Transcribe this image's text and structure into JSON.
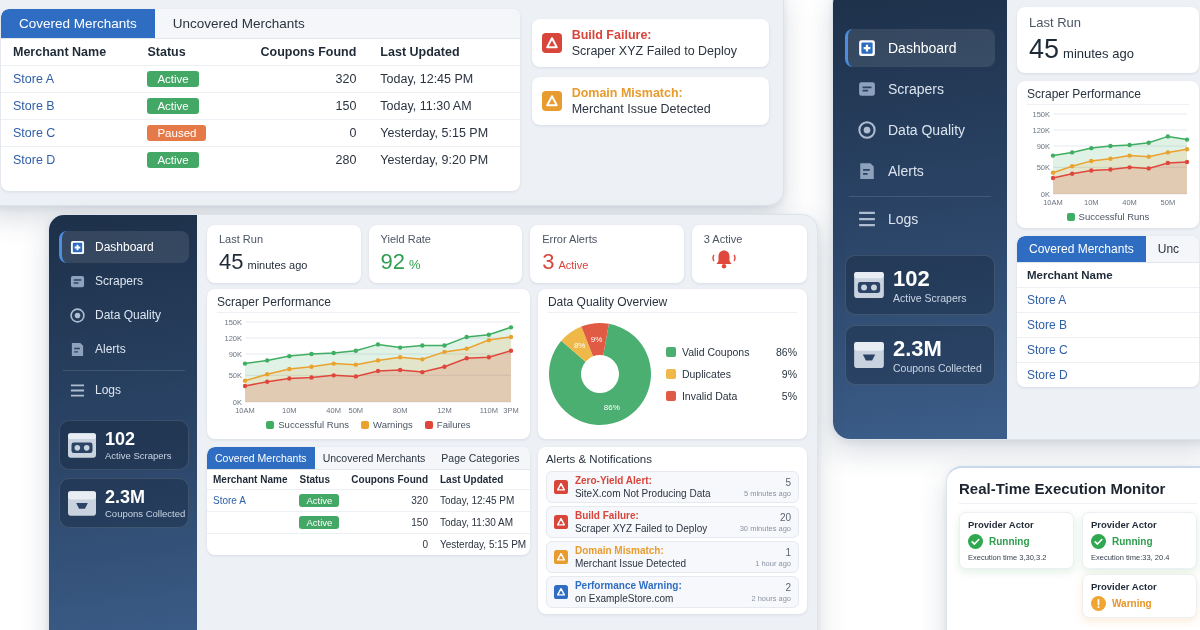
{
  "merchants_panel": {
    "tabs": [
      {
        "label": "Covered Merchants",
        "selected": true
      },
      {
        "label": "Uncovered Merchants",
        "selected": false
      }
    ],
    "table": {
      "columns": [
        "Merchant Name",
        "Status",
        "Coupons Found",
        "Last Updated"
      ],
      "rows": [
        {
          "merchant": "Store A",
          "status": {
            "label": "Active",
            "color": "#43a865"
          },
          "coupons": "320",
          "updated": "Today, 12:45 PM"
        },
        {
          "merchant": "Store B",
          "status": {
            "label": "Active",
            "color": "#43a865"
          },
          "coupons": "150",
          "updated": "Today, 11:30 AM"
        },
        {
          "merchant": "Store C",
          "status": {
            "label": "Paused",
            "color": "#e57a48"
          },
          "coupons": "0",
          "updated": "Yesterday, 5:15 PM"
        },
        {
          "merchant": "Store D",
          "status": {
            "label": "Active",
            "color": "#43a865"
          },
          "coupons": "280",
          "updated": "Yesterday, 9:20 PM"
        }
      ]
    },
    "alerts": [
      {
        "kind": "error",
        "title": "Build Failure:",
        "message": "Scraper XYZ Failed to Deploy"
      },
      {
        "kind": "warning",
        "title": "Domain Mismatch:",
        "message": "Merchant Issue Detected"
      }
    ]
  },
  "right_dashboard": {
    "sidebar": {
      "items": [
        {
          "kind": "dashboard",
          "label": "Dashboard",
          "selected": true
        },
        {
          "kind": "scrapers",
          "label": "Scrapers",
          "selected": false
        },
        {
          "kind": "quality",
          "label": "Data Quality",
          "selected": false
        },
        {
          "kind": "alerts",
          "label": "Alerts",
          "selected": false
        },
        {
          "kind": "logs",
          "label": "Logs",
          "selected": false
        }
      ],
      "stats": [
        {
          "kind": "scrapers",
          "value": "102",
          "label": "Active Scrapers"
        },
        {
          "kind": "coupons",
          "value": "2.3M",
          "label": "Coupons Collected"
        }
      ]
    },
    "last_run": {
      "label": "Last Run",
      "value": "45",
      "unit": "minutes ago"
    },
    "performance": {
      "chart_data": {
        "type": "area",
        "title": "Scraper Performance",
        "categories": [
          "10AM",
          null,
          "10M",
          null,
          "40M",
          null,
          "50M",
          null
        ],
        "ylim": [
          0,
          150000
        ],
        "yticks": [
          {
            "value": 0,
            "label": "0K"
          },
          {
            "value": 50000,
            "label": "50K"
          },
          {
            "value": 90000,
            "label": "90K"
          },
          {
            "value": 120000,
            "label": "120K"
          },
          {
            "value": 150000,
            "label": "150K"
          }
        ],
        "grid": true,
        "series": [
          {
            "name": "Successful Runs",
            "color": "#3fae63",
            "values": [
              72000,
              78000,
              86000,
              90000,
              92000,
              96000,
              108000,
              102000
            ]
          },
          {
            "color": "#eaa22f",
            "values": [
              40000,
              52000,
              62000,
              66000,
              72000,
              70000,
              78000,
              84000
            ]
          },
          {
            "color": "#e0473c",
            "values": [
              30000,
              38000,
              44000,
              46000,
              50000,
              48000,
              58000,
              60000
            ]
          }
        ]
      }
    },
    "tabs": [
      {
        "label": "Covered Merchants",
        "selected": true
      },
      {
        "label": "Unc",
        "selected": false
      }
    ],
    "table": {
      "columns": [
        "Merchant Name"
      ],
      "rows": [
        {
          "merchant": "Store A"
        },
        {
          "merchant": "Store B"
        },
        {
          "merchant": "Store C"
        },
        {
          "merchant": "Store D"
        }
      ]
    }
  },
  "main_dashboard": {
    "sidebar": {
      "items": [
        {
          "kind": "dashboard",
          "label": "Dashboard",
          "selected": true
        },
        {
          "kind": "scrapers",
          "label": "Scrapers",
          "selected": false
        },
        {
          "kind": "quality",
          "label": "Data Quality",
          "selected": false
        },
        {
          "kind": "alerts",
          "label": "Alerts",
          "selected": false
        },
        {
          "kind": "logs",
          "label": "Logs",
          "selected": false
        }
      ],
      "stats": [
        {
          "kind": "scrapers",
          "value": "102",
          "label": "Active Scrapers"
        },
        {
          "kind": "coupons",
          "value": "2.3M",
          "label": "Coupons Collected"
        }
      ]
    },
    "last_run": {
      "label": "Last Run",
      "value": "45",
      "unit": "minutes ago"
    },
    "yield_rate": {
      "label": "Yield Rate",
      "value": "92",
      "unit": "%"
    },
    "error_alerts": {
      "label": "Error Alerts",
      "value": "3",
      "unit": "Active"
    },
    "active_alerts": {
      "label": "3 Active"
    },
    "performance": {
      "chart_data": {
        "type": "area",
        "title": "Scraper Performance",
        "categories": [
          "10AM",
          null,
          "10M",
          null,
          "40M",
          "50M",
          null,
          "80M",
          null,
          "12M",
          null,
          "110M",
          "3PM"
        ],
        "ylim": [
          0,
          150000
        ],
        "yticks": [
          {
            "value": 0,
            "label": "0K"
          },
          {
            "value": 50000,
            "label": "50K"
          },
          {
            "value": 90000,
            "label": "90K"
          },
          {
            "value": 120000,
            "label": "120K"
          },
          {
            "value": 150000,
            "label": "150K"
          }
        ],
        "grid": true,
        "series": [
          {
            "name": "Successful Runs",
            "color": "#3fae63",
            "values": [
              72000,
              78000,
              86000,
              90000,
              92000,
              96000,
              108000,
              102000,
              106000,
              106000,
              122000,
              126000,
              140000
            ]
          },
          {
            "name": "Warnings",
            "color": "#eaa22f",
            "values": [
              40000,
              52000,
              62000,
              66000,
              72000,
              70000,
              78000,
              84000,
              80000,
              94000,
              100000,
              116000,
              122000
            ]
          },
          {
            "name": "Failures",
            "color": "#e0473c",
            "values": [
              30000,
              38000,
              44000,
              46000,
              50000,
              48000,
              58000,
              60000,
              56000,
              66000,
              82000,
              84000,
              96000
            ]
          }
        ]
      }
    },
    "data_quality": {
      "chart_data": {
        "type": "donut",
        "title": "Data Quality Overview",
        "categories": [
          "Valid Coupons",
          "Duplicates",
          "Invalid Data"
        ],
        "values": [
          86,
          8,
          9
        ],
        "colors": [
          "#4caf72",
          "#f0b849",
          "#e05a44"
        ],
        "value_labels": [
          "86%",
          "8%",
          "9%"
        ]
      },
      "legend_values": [
        "86%",
        "9%",
        "5%"
      ]
    },
    "tabs": [
      {
        "label": "Covered Merchants",
        "selected": true
      },
      {
        "label": "Uncovered Merchants",
        "selected": false
      },
      {
        "label": "Page Categories",
        "selected": false
      }
    ],
    "table": {
      "columns": [
        "Merchant Name",
        "Status",
        "Coupons Found",
        "Last Updated"
      ],
      "rows": [
        {
          "merchant": "Store A",
          "status": {
            "label": "Active",
            "color": "#43a865"
          },
          "coupons": "320",
          "updated": "Today, 12:45 PM"
        },
        {
          "status": {
            "label": "Active",
            "color": "#43a865"
          },
          "coupons": "150",
          "updated": "Today, 11:30 AM"
        },
        {
          "coupons": "0",
          "updated": "Yesterday, 5:15 PM"
        }
      ]
    },
    "notifications": {
      "title": "Alerts & Notifications",
      "items": [
        {
          "kind": "error",
          "title": "Zero-Yield Alert:",
          "message": "SiteX.com Not Producing Data",
          "count": "5",
          "time": "5 minutes ago"
        },
        {
          "kind": "error",
          "title": "Build Failure:",
          "message": "Scraper XYZ Failed to Deploy",
          "count": "20",
          "time": "30 minutes ago"
        },
        {
          "kind": "warning",
          "title": "Domain Mismatch:",
          "message": "Merchant Issue Detected",
          "count": "1",
          "time": "1 hour ago"
        },
        {
          "kind": "info",
          "title": "Performance Warning:",
          "message": "on ExampleStore.com",
          "count": "2",
          "time": "2 hours ago"
        }
      ]
    }
  },
  "execution_monitor": {
    "title": "Real-Time Execution Monitor",
    "columns": [
      {
        "cards": [
          {
            "kind": "running",
            "name": "Provider Actor",
            "status": "Running",
            "detail": "Execution time 3,30,3.2"
          }
        ]
      },
      {
        "cards": [
          {
            "kind": "running",
            "name": "Provider Actor",
            "status": "Running",
            "detail": "Execution time:33, 20.4"
          },
          {
            "kind": "warning",
            "name": "Provider Actor",
            "status": "Warning"
          }
        ]
      }
    ]
  }
}
